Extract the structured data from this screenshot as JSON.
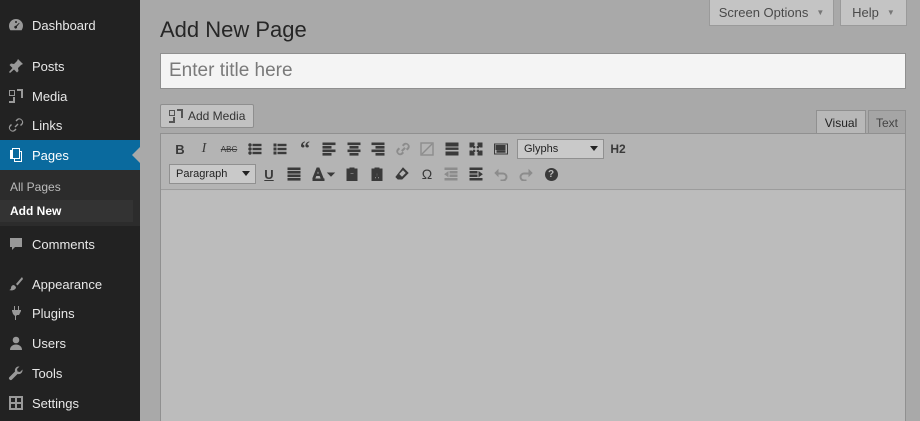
{
  "sidebar": {
    "items": [
      {
        "label": "Dashboard",
        "icon": "dashboard-icon"
      },
      {
        "label": "Posts",
        "icon": "pin-icon"
      },
      {
        "label": "Media",
        "icon": "media-icon"
      },
      {
        "label": "Links",
        "icon": "link-icon"
      },
      {
        "label": "Pages",
        "icon": "pages-icon"
      },
      {
        "label": "Comments",
        "icon": "comment-icon"
      },
      {
        "label": "Appearance",
        "icon": "brush-icon"
      },
      {
        "label": "Plugins",
        "icon": "plug-icon"
      },
      {
        "label": "Users",
        "icon": "user-icon"
      },
      {
        "label": "Tools",
        "icon": "wrench-icon"
      },
      {
        "label": "Settings",
        "icon": "settings-icon"
      }
    ],
    "submenu": [
      {
        "label": "All Pages"
      },
      {
        "label": "Add New"
      }
    ]
  },
  "screen_meta": {
    "screen_options": "Screen Options",
    "help": "Help"
  },
  "page": {
    "title": "Add New Page",
    "title_placeholder": "Enter title here"
  },
  "editor": {
    "add_media": "Add Media",
    "tab_visual": "Visual",
    "tab_text": "Text",
    "glyphs_select": "Glyphs",
    "format_select": "Paragraph",
    "h2_label": "H2",
    "bold_label": "B",
    "italic_label": "I",
    "strike_label": "ABC",
    "underline_label": "U",
    "omega_label": "Ω",
    "help_label": "?"
  },
  "colors": {
    "sidebar_bg": "#222222",
    "active_menu": "#0a6a9e",
    "page_bg": "#a9a9a9"
  }
}
